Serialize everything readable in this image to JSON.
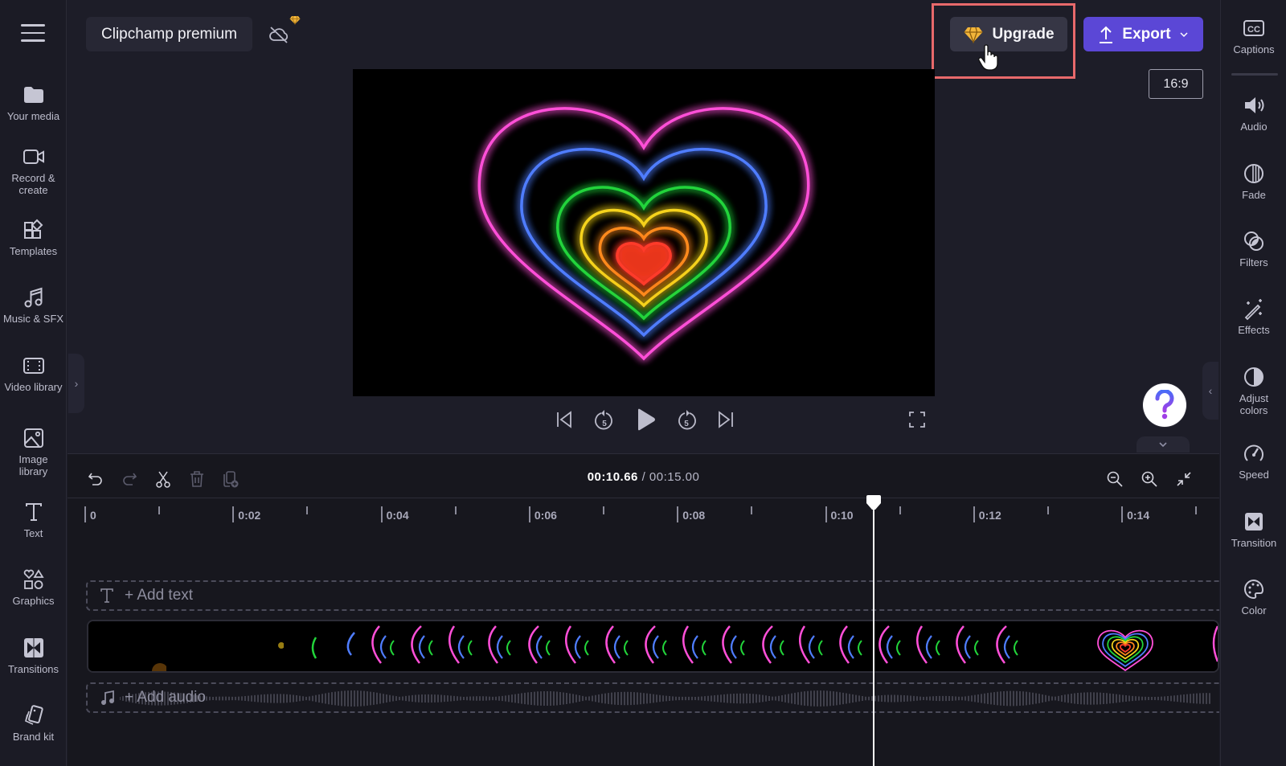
{
  "topbar": {
    "menu_icon": "hamburger-icon",
    "project_name": "Clipchamp premium",
    "cloud_status_icon": "cloud-off-icon",
    "premium_badge_icon": "diamond-icon",
    "upgrade_label": "Upgrade",
    "export_label": "Export",
    "aspect_ratio": "16:9"
  },
  "left_sidebar": {
    "items": [
      {
        "label": "Your media",
        "icon": "folder-icon"
      },
      {
        "label": "Record &\ncreate",
        "icon": "video-camera-icon"
      },
      {
        "label": "Templates",
        "icon": "templates-icon"
      },
      {
        "label": "Music & SFX",
        "icon": "music-icon"
      },
      {
        "label": "Video library",
        "icon": "film-icon"
      },
      {
        "label": "Image\nlibrary",
        "icon": "image-icon"
      },
      {
        "label": "Text",
        "icon": "text-icon"
      },
      {
        "label": "Graphics",
        "icon": "shapes-icon"
      },
      {
        "label": "Transitions",
        "icon": "transition-icon"
      },
      {
        "label": "Brand kit",
        "icon": "brand-kit-icon"
      }
    ]
  },
  "right_sidebar": {
    "items": [
      {
        "label": "Captions",
        "icon": "cc-icon"
      },
      {
        "label": "Audio",
        "icon": "speaker-icon"
      },
      {
        "label": "Fade",
        "icon": "fade-icon"
      },
      {
        "label": "Filters",
        "icon": "filters-icon"
      },
      {
        "label": "Effects",
        "icon": "magic-wand-icon"
      },
      {
        "label": "Adjust\ncolors",
        "icon": "contrast-icon"
      },
      {
        "label": "Speed",
        "icon": "speedometer-icon"
      },
      {
        "label": "Transition",
        "icon": "transition-icon"
      },
      {
        "label": "Color",
        "icon": "palette-icon"
      }
    ]
  },
  "player": {
    "help_label": "?",
    "colors": [
      "#ff4fd8",
      "#4f7dff",
      "#22d43a",
      "#f5d31c",
      "#ff8a1c",
      "#ff3b2a"
    ]
  },
  "timeline": {
    "current_time": "00:10.66",
    "separator": "/",
    "total_time": "00:15.00",
    "ruler_labels": [
      "0",
      "0:02",
      "0:04",
      "0:06",
      "0:08",
      "0:10",
      "0:12",
      "0:14"
    ],
    "playhead_seconds": 10.66,
    "add_text_label": "+ Add text",
    "add_audio_label": "+ Add audio"
  }
}
